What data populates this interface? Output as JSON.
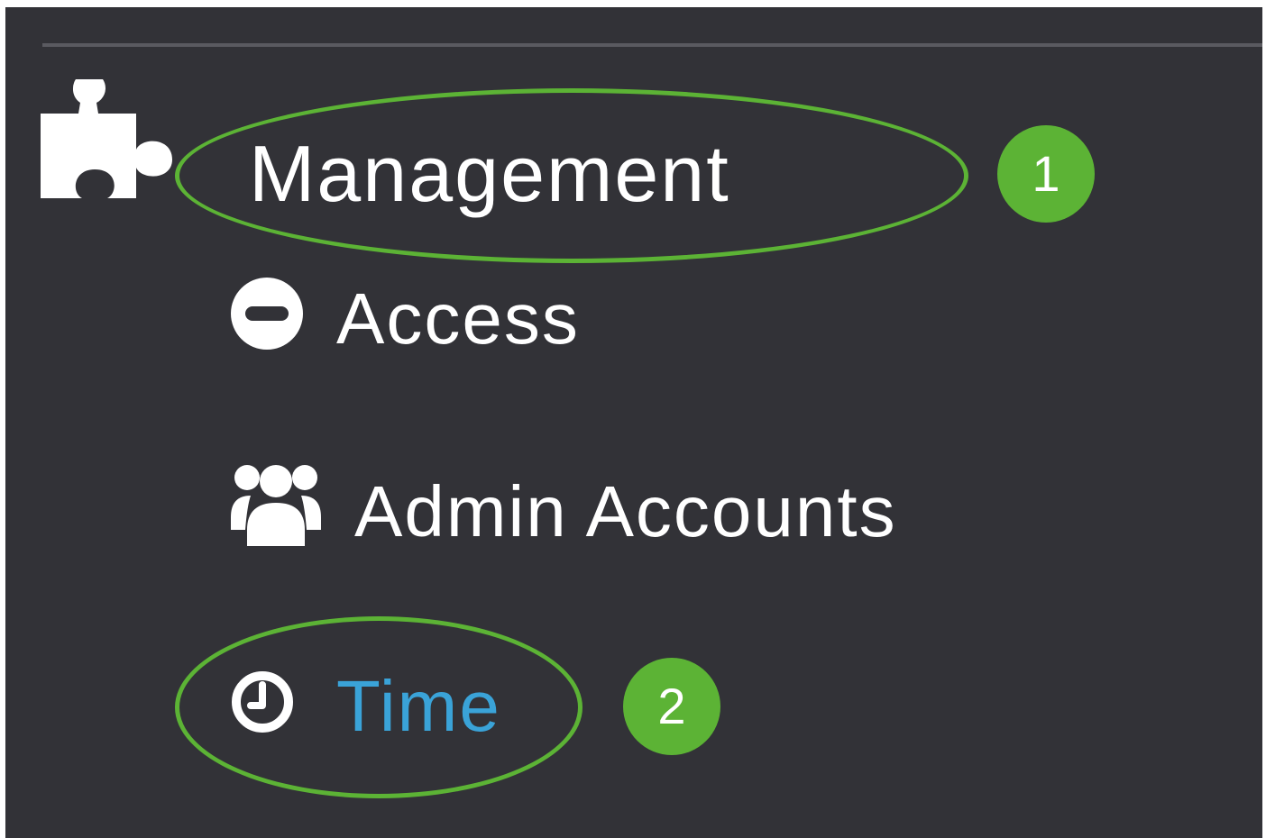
{
  "nav": {
    "section": {
      "label": "Management",
      "icon": "puzzle-icon"
    },
    "items": [
      {
        "label": "Access",
        "icon": "minus-circle-icon",
        "active": false
      },
      {
        "label": "Admin Accounts",
        "icon": "users-icon",
        "active": false
      },
      {
        "label": "Time",
        "icon": "clock-icon",
        "active": true
      }
    ]
  },
  "annotations": {
    "step1": "1",
    "step2": "2"
  },
  "colors": {
    "panel_bg": "#323237",
    "text": "#ffffff",
    "active_text": "#3aa3d8",
    "highlight": "#5cb335"
  }
}
